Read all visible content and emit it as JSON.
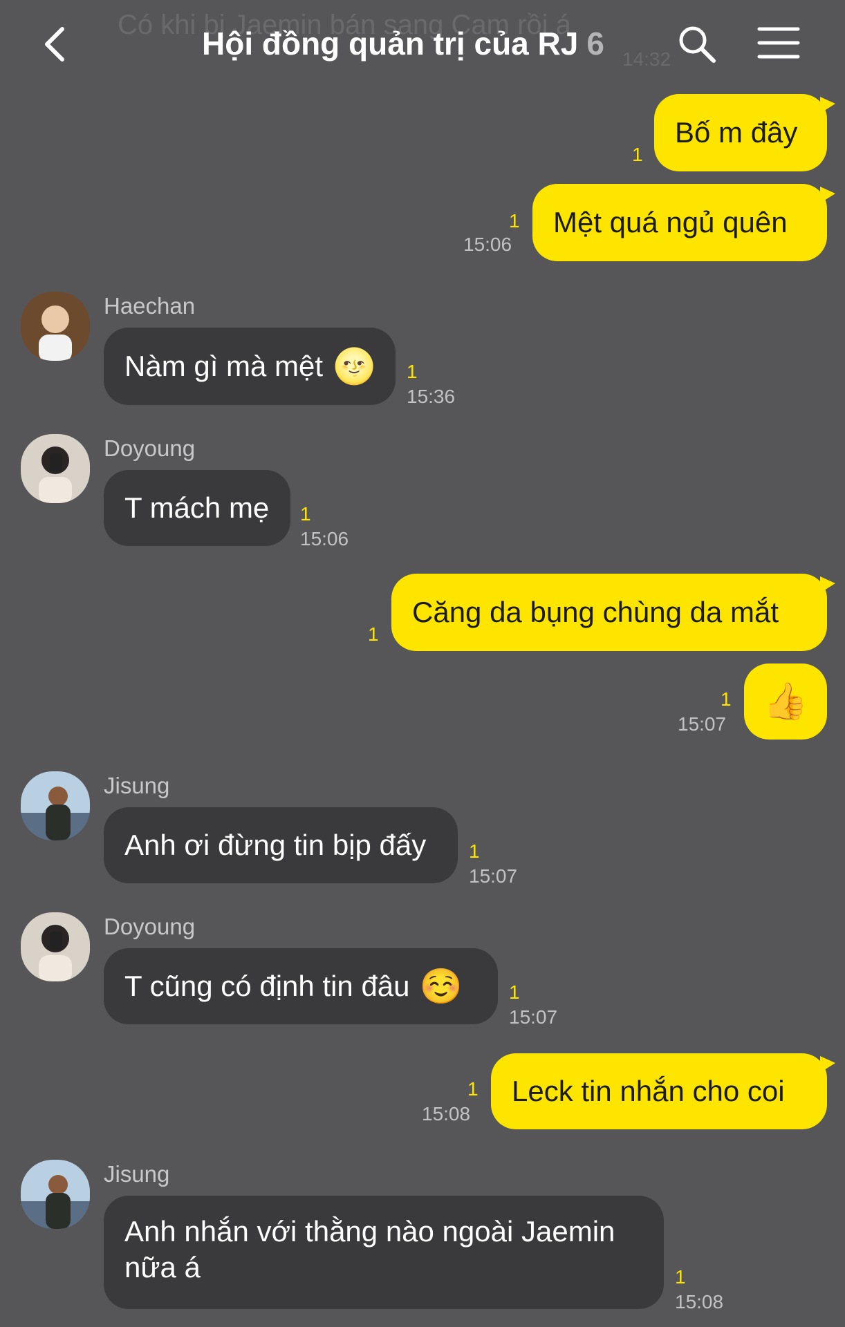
{
  "header": {
    "ghost_preview": "Có khi bị Jaemin bán sang Cam rồi á",
    "ghost_time": "14:32",
    "title": "Hội đồng quản trị của RJ",
    "member_count": "6"
  },
  "messages": [
    {
      "text": "Bố m đây",
      "unread": "1"
    },
    {
      "text": "Mệt quá ngủ quên",
      "unread": "1",
      "time": "15:06"
    },
    {
      "sender": "Haechan",
      "text": "Nàm gì mà mệt",
      "emoji": "🌝",
      "unread": "1",
      "time": "15:36"
    },
    {
      "sender": "Doyoung",
      "text": "T mách mẹ",
      "unread": "1",
      "time": "15:06"
    },
    {
      "text": "Căng da bụng chùng da mắt",
      "unread": "1"
    },
    {
      "emoji": "👍",
      "unread": "1",
      "time": "15:07"
    },
    {
      "sender": "Jisung",
      "text": "Anh ơi đừng tin bịp đấy",
      "unread": "1",
      "time": "15:07"
    },
    {
      "sender": "Doyoung",
      "text": "T cũng có định tin đâu",
      "emoji": "☺️",
      "unread": "1",
      "time": "15:07"
    },
    {
      "text": "Leck tin nhắn cho coi",
      "unread": "1",
      "time": "15:08"
    },
    {
      "sender": "Jisung",
      "text": "Anh nhắn với thằng nào ngoài Jaemin nữa á",
      "unread": "1",
      "time": "15:08"
    }
  ],
  "colors": {
    "background": "#565658",
    "outgoing_bubble": "#fee500",
    "incoming_bubble": "#3a3a3c",
    "unread_count": "#fee500"
  },
  "icons": [
    "back-arrow-icon",
    "search-icon",
    "menu-icon"
  ]
}
